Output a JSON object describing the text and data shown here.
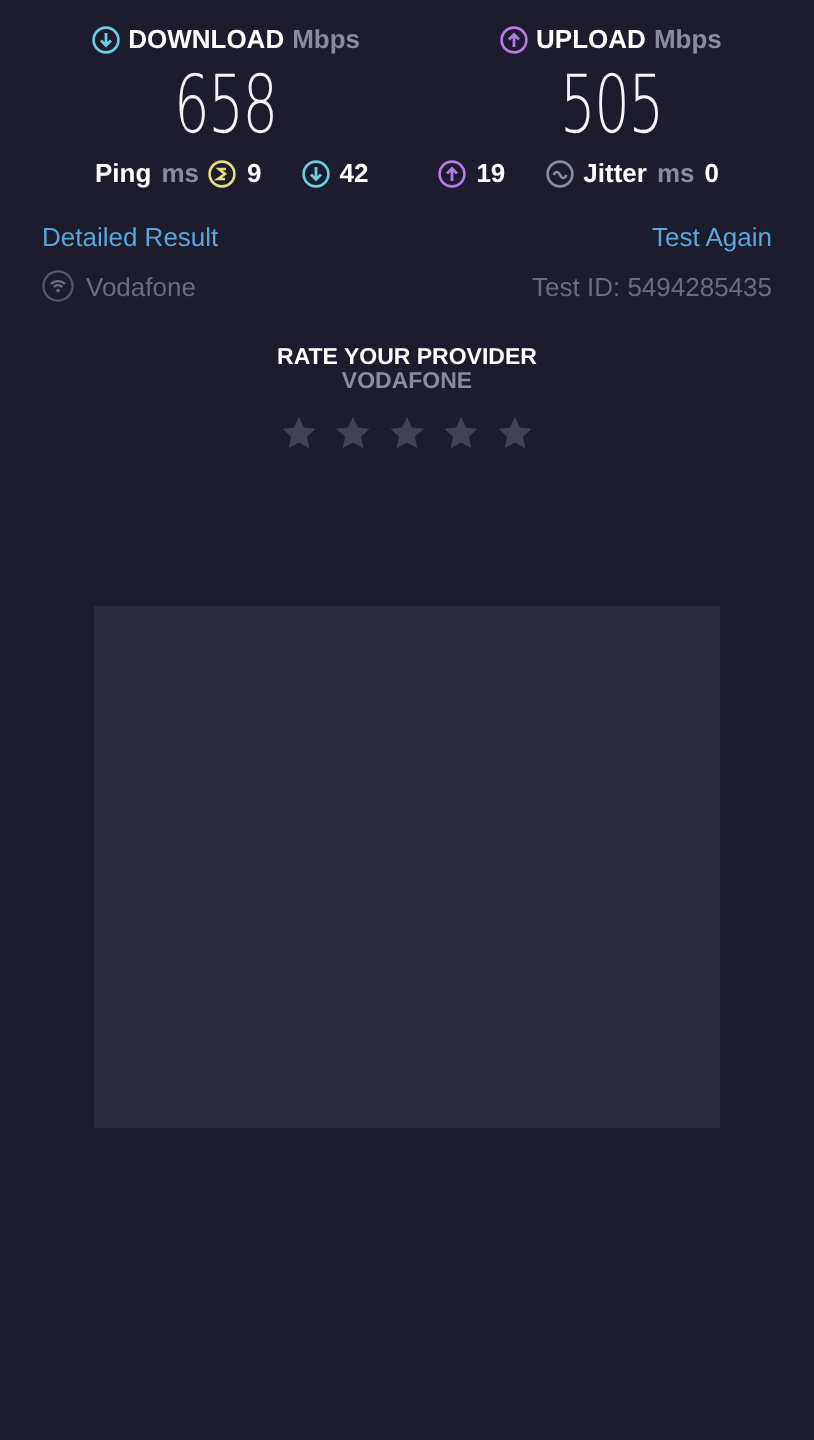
{
  "speeds": [
    {
      "kind": "download",
      "label": "DOWNLOAD",
      "unit": "Mbps",
      "value": "658"
    },
    {
      "kind": "upload",
      "label": "UPLOAD",
      "unit": "Mbps",
      "value": "505"
    }
  ],
  "metrics": {
    "ping_label": "Ping",
    "ping_unit": "ms",
    "idle": "9",
    "download": "42",
    "upload": "19",
    "jitter_label": "Jitter",
    "jitter_unit": "ms",
    "jitter": "0"
  },
  "links": {
    "detailed": "Detailed Result",
    "again": "Test Again"
  },
  "info": {
    "provider": "Vodafone",
    "test_id": "Test ID: 5494285435"
  },
  "rating": {
    "title": "RATE YOUR PROVIDER",
    "provider": "VODAFONE",
    "stars": 0
  }
}
